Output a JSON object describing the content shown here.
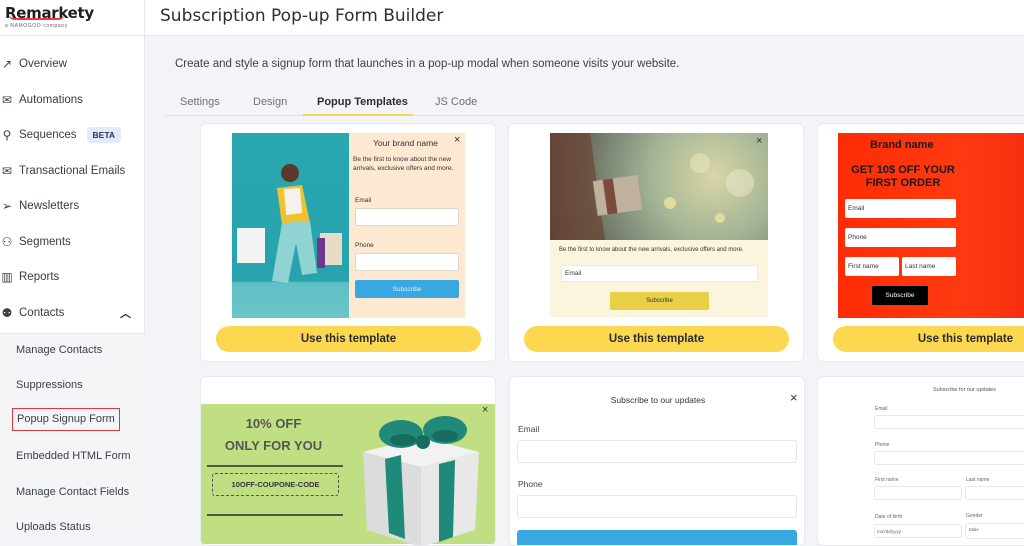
{
  "brand": {
    "logo_text": "Remarkety",
    "logo_subtitle": "a NAMOGOO company"
  },
  "header": {
    "title": "Subscription Pop-up Form Builder"
  },
  "description": "Create and style a signup form that launches in a pop-up modal when someone visits your website.",
  "sidebar": {
    "items": [
      {
        "label": "Overview",
        "icon": "trend-up-icon"
      },
      {
        "label": "Automations",
        "icon": "automation-icon"
      },
      {
        "label": "Sequences",
        "icon": "sequence-icon",
        "badge": "BETA"
      },
      {
        "label": "Transactional Emails",
        "icon": "transactional-email-icon"
      },
      {
        "label": "Newsletters",
        "icon": "paper-plane-icon"
      },
      {
        "label": "Segments",
        "icon": "segments-icon"
      },
      {
        "label": "Reports",
        "icon": "reports-icon"
      },
      {
        "label": "Contacts",
        "icon": "contacts-icon",
        "expanded": true
      }
    ],
    "sub_items": [
      {
        "label": "Manage Contacts"
      },
      {
        "label": "Suppressions"
      },
      {
        "label": "Popup Signup Form",
        "active": true
      },
      {
        "label": "Embedded HTML Form"
      },
      {
        "label": "Manage Contact Fields"
      },
      {
        "label": "Uploads Status"
      }
    ]
  },
  "tabs": [
    {
      "label": "Settings"
    },
    {
      "label": "Design"
    },
    {
      "label": "Popup Templates",
      "active": true
    },
    {
      "label": "JS Code"
    }
  ],
  "templates": {
    "use_label": "Use this template",
    "t1": {
      "brand": "Your brand name",
      "text": "Be the first to know about the new arrivals, exclusive offers and more.",
      "email_label": "Email",
      "phone_label": "Phone",
      "button": "Subscribe",
      "close": "×"
    },
    "t2": {
      "text": "Be the first to know about the new arrivals, exclusive offers and more.",
      "email_placeholder": "Email",
      "button": "Subscribe",
      "close": "×"
    },
    "t3": {
      "brand": "Brand name",
      "headline": "GET 10$ OFF YOUR FIRST ORDER",
      "email_placeholder": "Email",
      "phone_placeholder": "Phone",
      "first_name_placeholder": "First name",
      "last_name_placeholder": "Last name",
      "button": "Subscribe"
    },
    "t4": {
      "line1": "10% OFF",
      "line2": "ONLY FOR YOU",
      "coupon": "10OFF-COUPONE-CODE",
      "close": "×"
    },
    "t5": {
      "title": "Subscribe to our updates",
      "email_label": "Email",
      "phone_label": "Phone",
      "close": "×"
    },
    "t6": {
      "title": "Subscribe for our updates",
      "email_label": "Email",
      "phone_label": "Phone",
      "first_name_label": "First name",
      "last_name_label": "Last name",
      "dob_label": "Date of birth",
      "gender_label": "Gender",
      "dob_placeholder": "mm/dd/yyyy",
      "gender_value": "Male"
    }
  },
  "colors": {
    "accent_yellow": "#fbd84f",
    "active_outline": "#e2353b",
    "subscribe_blue": "#3aa8e0"
  }
}
